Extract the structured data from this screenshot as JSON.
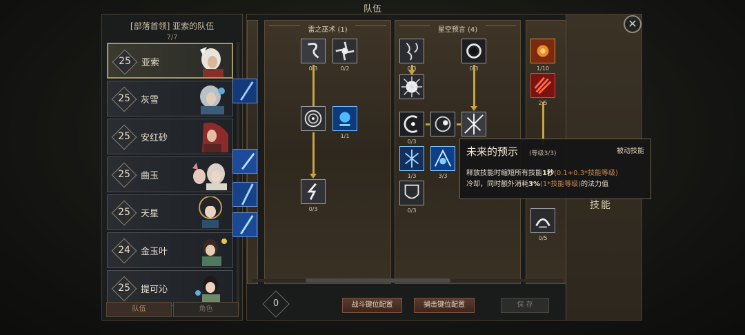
{
  "window_title": "队伍",
  "roster": {
    "title": "[部落首领] 亚索的队伍",
    "count": "7/7",
    "members": [
      {
        "level": "25",
        "name": "亚索",
        "selected": true
      },
      {
        "level": "25",
        "name": "灰雪"
      },
      {
        "level": "25",
        "name": "安红砂"
      },
      {
        "level": "25",
        "name": "曲玉"
      },
      {
        "level": "25",
        "name": "天星"
      },
      {
        "level": "24",
        "name": "金玉叶"
      },
      {
        "level": "25",
        "name": "提可沁"
      }
    ],
    "tabs": [
      "队伍",
      "角色"
    ]
  },
  "skill_tree": {
    "columns": [
      {
        "title": "雷之巫术 (1)"
      },
      {
        "title": "星空预言 (4)"
      }
    ],
    "skills_col1": [
      "0/3",
      "0/2",
      "1/1",
      "0/3"
    ],
    "skills_col2": [
      "0/3",
      "0/3",
      "0/3",
      "1/3",
      "3/3",
      "0/3"
    ],
    "skills_col3": [
      "1/10",
      "2/5",
      "0/5"
    ],
    "side_label": "技能"
  },
  "bottom": {
    "points": "0",
    "combat_keys": "战斗键位配置",
    "capture_keys": "捕击键位配置",
    "save": "保 存"
  },
  "tooltip": {
    "name": "未来的预示",
    "level": "(等级3/3)",
    "type": "被动技能",
    "line1_a": "释放技能时缩短所有技能",
    "line1_b": "1秒",
    "line1_c": "(0.1+0.3*技能等级)",
    "line2_a": "冷却，同时额外消耗",
    "line2_b": "3%",
    "line2_c": "(1*技能等级)",
    "line2_d": "的法力值"
  },
  "colors": {
    "link": "#c9a441",
    "accent": "#c88a4c"
  }
}
